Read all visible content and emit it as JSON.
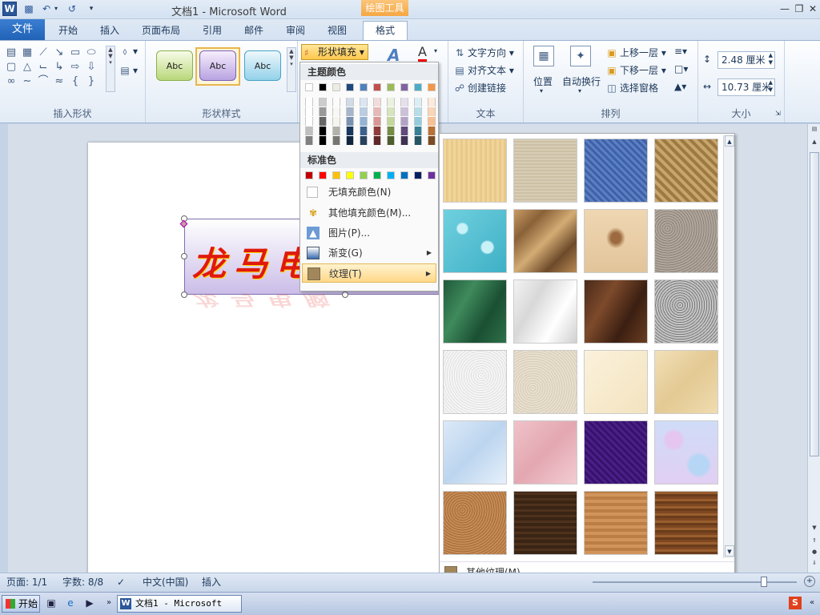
{
  "window": {
    "title": "文档1  -  Microsoft Word",
    "context_tab": "绘图工具"
  },
  "tabs": [
    "文件",
    "开始",
    "插入",
    "页面布局",
    "引用",
    "邮件",
    "审阅",
    "视图",
    "格式"
  ],
  "ribbon": {
    "groups": {
      "insert_shapes": "插入形状",
      "shape_styles": "形状样式",
      "text": "文本",
      "arrange": "排列",
      "size": "大小"
    },
    "style_samples": [
      "Abc",
      "Abc",
      "Abc"
    ],
    "shape_fill_label": "形状填充",
    "text_items": [
      "文字方向",
      "对齐文本",
      "创建链接"
    ],
    "arrange": {
      "position": "位置",
      "wrap": "自动换行",
      "bring_forward": "上移一层",
      "send_backward": "下移一层",
      "selection_pane": "选择窗格"
    },
    "size": {
      "height": "2.48 厘米",
      "width": "10.73 厘米"
    }
  },
  "fill_menu": {
    "theme_colors_title": "主题颜色",
    "standard_colors_title": "标准色",
    "items": [
      "无填充颜色(N)",
      "其他填充颜色(M)...",
      "图片(P)...",
      "渐变(G)",
      "纹理(T)"
    ],
    "theme_colors": [
      "#ffffff",
      "#000000",
      "#eeece1",
      "#1f497d",
      "#4f81bd",
      "#c0504d",
      "#9bbb59",
      "#8064a2",
      "#4bacc6",
      "#f79646"
    ],
    "standard_colors": [
      "#c00000",
      "#ff0000",
      "#ffc000",
      "#ffff00",
      "#92d050",
      "#00b050",
      "#00b0f0",
      "#0070c0",
      "#002060",
      "#7030a0"
    ]
  },
  "texture_panel": {
    "more_textures": "其他纹理(M)...",
    "textures": [
      "纸莎草纸",
      "画布",
      "斜纹布",
      "编织物",
      "水滴",
      "揉皱的纸",
      "鱼类化石",
      "沙滩",
      "绿色大理石",
      "白色大理石",
      "褐色大理石",
      "花岗岩",
      "新闻纸",
      "再生纸",
      "羊皮纸",
      "信纸",
      "蓝色面巾纸",
      "粉色面巾纸",
      "紫色网格",
      "花束",
      "软木塞",
      "胡桃",
      "栎木",
      "深色木质"
    ]
  },
  "document": {
    "wordart_text": "龙马电",
    "wordart_reflection": "龙马电脑"
  },
  "statusbar": {
    "page": "页面: 1/1",
    "words": "字数: 8/8",
    "language": "中文(中国)",
    "mode": "插入"
  },
  "taskbar": {
    "start": "开始",
    "word_window": "文档1 - Microsoft Word"
  }
}
